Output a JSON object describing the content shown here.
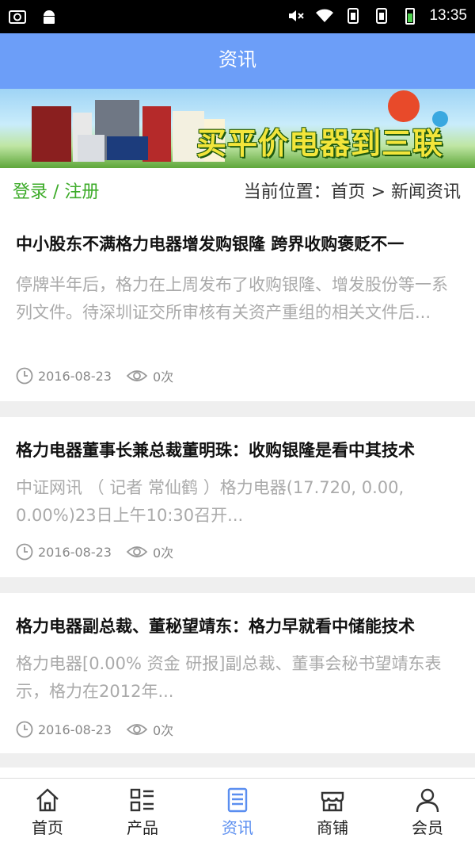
{
  "status_bar": {
    "time": "13:35"
  },
  "header": {
    "title": "资讯"
  },
  "banner": {
    "slogan": "买平价电器到三联"
  },
  "breadcrumb": {
    "login": "登录",
    "sep": " / ",
    "register": "注册",
    "location": "当前位置：首页 > 新闻资讯"
  },
  "news": [
    {
      "title": "中小股东不满格力电器增发购银隆 跨界收购褒贬不一",
      "summary": "停牌半年后，格力在上周发布了收购银隆、增发股份等一系列文件。待深圳证交所审核有关资产重组的相关文件后...",
      "date": "2016-08-23",
      "views": "0次"
    },
    {
      "title": "格力电器董事长兼总裁董明珠：收购银隆是看中其技术",
      "summary": "中证网讯 （ 记者 常仙鹤 ）格力电器(17.720, 0.00, 0.00%)23日上午10:30召开...",
      "date": "2016-08-23",
      "views": "0次"
    },
    {
      "title": "格力电器副总裁、董秘望靖东：格力早就看中储能技术",
      "summary": "格力电器[0.00% 资金 研报]副总裁、董事会秘书望靖东表示，格力在2012年...",
      "date": "2016-08-23",
      "views": "0次"
    }
  ],
  "tabs": [
    {
      "label": "首页",
      "icon": "home-icon"
    },
    {
      "label": "产品",
      "icon": "grid-list-icon"
    },
    {
      "label": "资讯",
      "icon": "news-icon",
      "active": true
    },
    {
      "label": "商铺",
      "icon": "store-icon"
    },
    {
      "label": "会员",
      "icon": "user-icon"
    }
  ],
  "colors": {
    "header": "#6c9ef8",
    "accent": "#5a8ef0",
    "login": "#3cab28"
  }
}
